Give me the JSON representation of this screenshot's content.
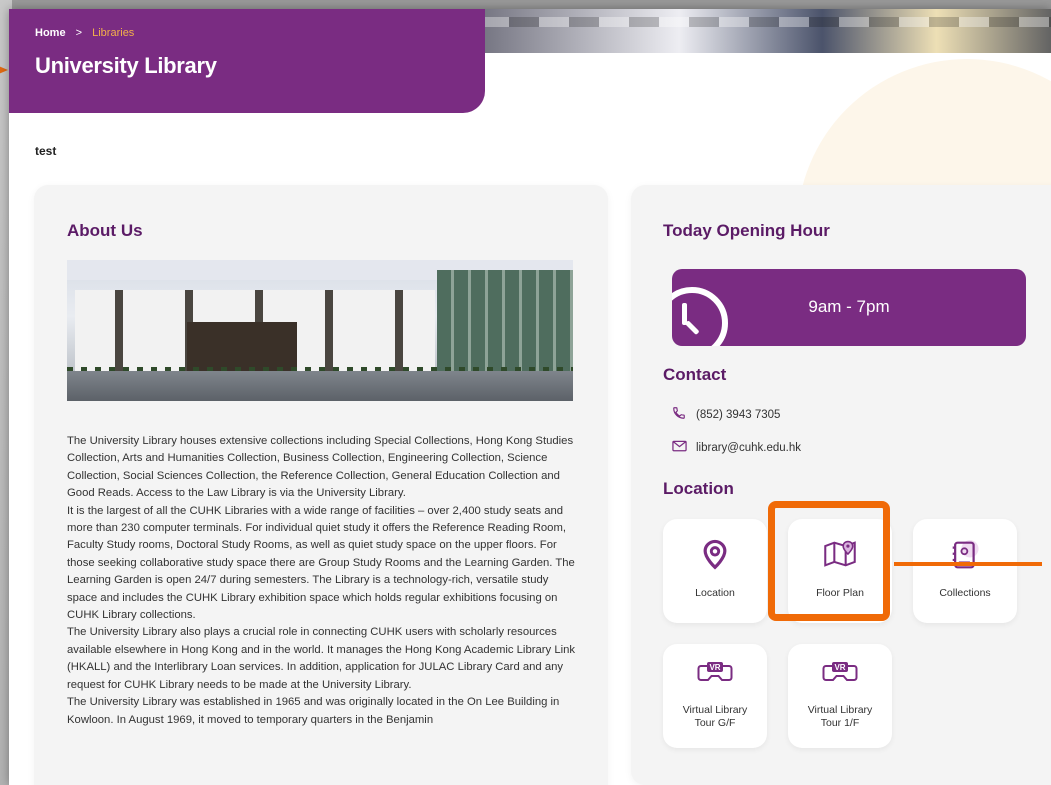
{
  "breadcrumb": {
    "home": "Home",
    "separator": ">",
    "current": "Libraries"
  },
  "page_title": "University Library",
  "test_text": "test",
  "about": {
    "title": "About Us",
    "paragraphs": [
      "The University Library houses extensive collections including Special Collections, Hong Kong Studies Collection, Arts and Humanities Collection, Business Collection, Engineering Collection, Science Collection, Social Sciences Collection, the Reference Collection, General Education Collection and Good Reads. Access to the Law Library is via the University Library.",
      "It is the largest of all the CUHK Libraries with a wide range of facilities – over 2,400 study seats and more than 230 computer terminals. For individual quiet study it offers the Reference Reading Room, Faculty Study rooms, Doctoral Study Rooms, as well as quiet study space on the upper floors. For those seeking collaborative study space there are Group Study Rooms and the Learning Garden. The Learning Garden is open 24/7 during semesters. The Library is a technology-rich, versatile study space and includes the CUHK Library exhibition space which holds regular exhibitions focusing on CUHK Library collections.",
      "The University Library also plays a crucial role in connecting CUHK users with scholarly resources available elsewhere in Hong Kong and in the world. It manages the Hong Kong Academic Library Link (HKALL) and the Interlibrary Loan services. In addition, application for JULAC Library Card and any request for CUHK Library needs to be made at the University Library.",
      "The University Library was established in 1965 and was originally located in the On Lee Building in Kowloon. In August 1969, it moved to temporary quarters in the Benjamin"
    ]
  },
  "opening": {
    "title": "Today Opening Hour",
    "hours": "9am - 7pm"
  },
  "contact": {
    "title": "Contact",
    "phone": "(852) 3943 7305",
    "email": "library@cuhk.edu.hk"
  },
  "location": {
    "title": "Location",
    "tiles": [
      {
        "label": "Location",
        "icon": "map-pin-icon"
      },
      {
        "label": "Floor Plan",
        "icon": "floor-plan-map-icon"
      },
      {
        "label": "Collections",
        "icon": "collections-book-icon"
      },
      {
        "label": "Virtual Library\nTour G/F",
        "icon": "vr-headset-icon"
      },
      {
        "label": "Virtual Library\nTour 1/F",
        "icon": "vr-headset-icon"
      }
    ]
  },
  "colors": {
    "brand_purple": "#7a2c82",
    "title_purple": "#5b1b66",
    "breadcrumb_accent": "#f3b04a",
    "highlight_orange": "#f06a07"
  }
}
